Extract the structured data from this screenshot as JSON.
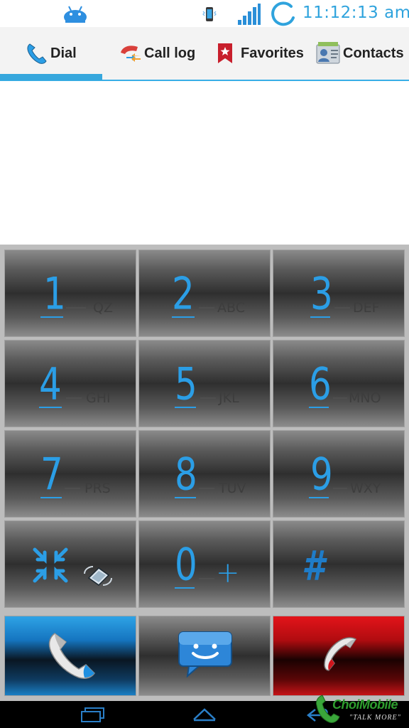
{
  "status_bar": {
    "time": "11:12:13 am",
    "accent": "#2fa3dd",
    "icons": [
      "android-icon",
      "phone-status-icon",
      "signal-icon",
      "sync-icon"
    ]
  },
  "tabs": [
    {
      "label": "Dial",
      "icon": "phone-handset-icon",
      "active": true
    },
    {
      "label": "Call log",
      "icon": "call-log-icon",
      "active": false
    },
    {
      "label": "Favorites",
      "icon": "star-bookmark-icon",
      "active": false
    },
    {
      "label": "Contacts",
      "icon": "contact-card-icon",
      "active": false
    }
  ],
  "dialpad": {
    "digit_color": "#2b9ee6",
    "keys": [
      {
        "digit": "1",
        "letters": "QZ"
      },
      {
        "digit": "2",
        "letters": "ABC"
      },
      {
        "digit": "3",
        "letters": "DEF"
      },
      {
        "digit": "4",
        "letters": "GHI"
      },
      {
        "digit": "5",
        "letters": "JKL"
      },
      {
        "digit": "6",
        "letters": "MNO"
      },
      {
        "digit": "7",
        "letters": "PRS"
      },
      {
        "digit": "8",
        "letters": "TUV"
      },
      {
        "digit": "9",
        "letters": "WXY"
      },
      {
        "digit": "",
        "letters": "",
        "icon": "collapse-icon"
      },
      {
        "digit": "0",
        "letters": "+"
      },
      {
        "digit": "#",
        "letters": ""
      }
    ],
    "actions": [
      {
        "name": "call",
        "icon": "call-icon",
        "color": "#1575c0"
      },
      {
        "name": "message",
        "icon": "message-icon"
      },
      {
        "name": "end",
        "icon": "end-call-icon",
        "color": "#e3141a"
      }
    ]
  },
  "nav_bar": {
    "icons": [
      "recent-apps-icon",
      "home-icon",
      "back-icon"
    ]
  },
  "watermark": {
    "brand": "ChoiMobile",
    "tagline": "\"TALK MORE\""
  }
}
